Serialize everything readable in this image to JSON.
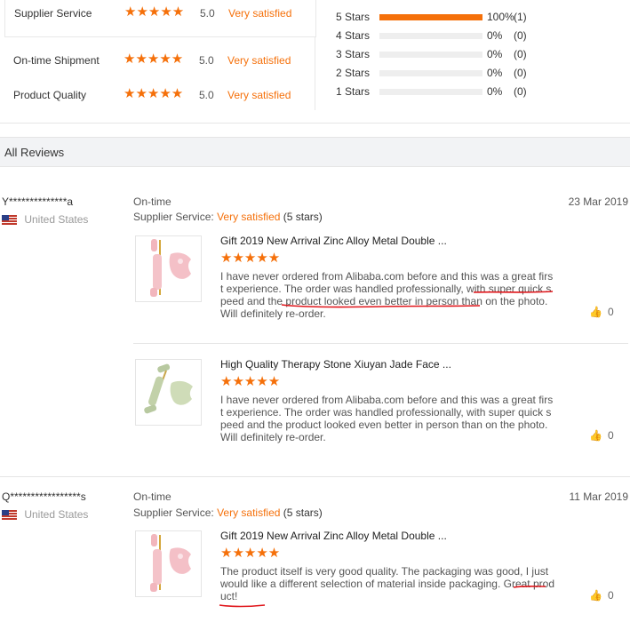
{
  "ratings": [
    {
      "label": "Supplier Service",
      "score": "5.0",
      "satisfaction": "Very satisfied"
    },
    {
      "label": "On-time Shipment",
      "score": "5.0",
      "satisfaction": "Very satisfied"
    },
    {
      "label": "Product Quality",
      "score": "5.0",
      "satisfaction": "Very satisfied"
    }
  ],
  "distribution": [
    {
      "label": "5 Stars",
      "pct": "100%",
      "count": "(1)",
      "fill": 1.0
    },
    {
      "label": "4 Stars",
      "pct": "0%",
      "count": "(0)",
      "fill": 0
    },
    {
      "label": "3 Stars",
      "pct": "0%",
      "count": "(0)",
      "fill": 0
    },
    {
      "label": "2 Stars",
      "pct": "0%",
      "count": "(0)",
      "fill": 0
    },
    {
      "label": "1 Stars",
      "pct": "0%",
      "count": "(0)",
      "fill": 0
    }
  ],
  "all_reviews_label": "All Reviews",
  "stars": "★★★★★",
  "reviews": [
    {
      "user": "Y**************a",
      "country": "United States",
      "date": "23 Mar 2019",
      "service_label_top": "On-time",
      "service_label": "Supplier Service:",
      "service_value": "Very satisfied",
      "service_stars": "(5 stars)",
      "items": [
        {
          "title": "Gift 2019 New Arrival Zinc Alloy Metal Double ...",
          "text": "I have never ordered from Alibaba.com before and this was a great first experience. The order was handled professionally, with super quick speed and the product looked even better in person than on the photo. Will definitely re-order.",
          "likes": "0",
          "stone": "pink"
        },
        {
          "title": "High Quality Therapy Stone Xiuyan Jade Face ...",
          "text": "I have never ordered from Alibaba.com before and this was a great first experience. The order was handled professionally, with super quick speed and the product looked even better in person than on the photo. Will definitely re-order.",
          "likes": "0",
          "stone": "jade"
        }
      ]
    },
    {
      "user": "Q*****************s",
      "country": "United States",
      "date": "11 Mar 2019",
      "service_label_top": "On-time",
      "service_label": "Supplier Service:",
      "service_value": "Very satisfied",
      "service_stars": "(5 stars)",
      "items": [
        {
          "title": "Gift 2019 New Arrival Zinc Alloy Metal Double ...",
          "text": "The product itself is very good quality. The packaging was good, I just would like a different selection of material inside packaging. Great product!",
          "likes": "0",
          "stone": "pink"
        }
      ]
    }
  ],
  "colors": {
    "accent": "#f5700a",
    "annotation": "#e0161b"
  },
  "icons": {
    "like": "thumbs-up-icon",
    "flag": "us-flag-icon"
  }
}
